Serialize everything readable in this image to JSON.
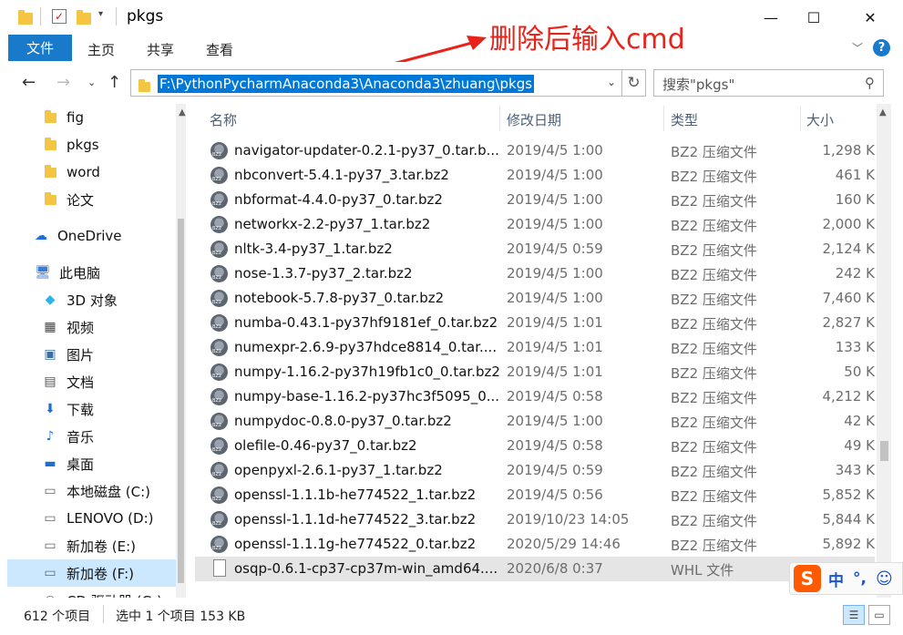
{
  "window": {
    "title": "pkgs",
    "minimize": "—",
    "maximize": "☐",
    "close": "✕"
  },
  "ribbon": {
    "tabs": [
      "文件",
      "主页",
      "共享",
      "查看"
    ],
    "help": "?"
  },
  "annotation": {
    "text": "删除后输入cmd",
    "color": "#e8231a"
  },
  "address": {
    "path": "F:\\PythonPycharmAnaconda3\\Anaconda3\\zhuang\\pkgs",
    "refresh": "↻"
  },
  "search": {
    "placeholder": "搜索\"pkgs\""
  },
  "sidebar": {
    "items": [
      {
        "label": "fig",
        "icon": "folder-icon"
      },
      {
        "label": "pkgs",
        "icon": "folder-icon"
      },
      {
        "label": "word",
        "icon": "folder-icon"
      },
      {
        "label": "论文",
        "icon": "folder-icon"
      },
      {
        "label": "OneDrive",
        "icon": "cloud-icon"
      },
      {
        "label": "此电脑",
        "icon": "computer-icon"
      },
      {
        "label": "3D 对象",
        "icon": "cube-icon"
      },
      {
        "label": "视频",
        "icon": "film-icon"
      },
      {
        "label": "图片",
        "icon": "picture-icon"
      },
      {
        "label": "文档",
        "icon": "document-icon"
      },
      {
        "label": "下载",
        "icon": "download-icon"
      },
      {
        "label": "音乐",
        "icon": "music-icon"
      },
      {
        "label": "桌面",
        "icon": "desktop-icon"
      },
      {
        "label": "本地磁盘 (C:)",
        "icon": "drive-icon"
      },
      {
        "label": "LENOVO (D:)",
        "icon": "drive-icon"
      },
      {
        "label": "新加卷 (E:)",
        "icon": "drive-icon"
      },
      {
        "label": "新加卷 (F:)",
        "icon": "drive-icon"
      },
      {
        "label": "CD 驱动器 (G:)",
        "icon": "cd-drive-icon"
      }
    ]
  },
  "columns": {
    "name": "名称",
    "date": "修改日期",
    "type": "类型",
    "size": "大小"
  },
  "files": [
    {
      "name": "navigator-updater-0.2.1-py37_0.tar.b...",
      "date": "2019/4/5 1:00",
      "type": "BZ2 压缩文件",
      "size": "1,298 K"
    },
    {
      "name": "nbconvert-5.4.1-py37_3.tar.bz2",
      "date": "2019/4/5 1:00",
      "type": "BZ2 压缩文件",
      "size": "461 K"
    },
    {
      "name": "nbformat-4.4.0-py37_0.tar.bz2",
      "date": "2019/4/5 1:00",
      "type": "BZ2 压缩文件",
      "size": "160 K"
    },
    {
      "name": "networkx-2.2-py37_1.tar.bz2",
      "date": "2019/4/5 1:00",
      "type": "BZ2 压缩文件",
      "size": "2,000 K"
    },
    {
      "name": "nltk-3.4-py37_1.tar.bz2",
      "date": "2019/4/5 0:59",
      "type": "BZ2 压缩文件",
      "size": "2,124 K"
    },
    {
      "name": "nose-1.3.7-py37_2.tar.bz2",
      "date": "2019/4/5 1:00",
      "type": "BZ2 压缩文件",
      "size": "242 K"
    },
    {
      "name": "notebook-5.7.8-py37_0.tar.bz2",
      "date": "2019/4/5 1:00",
      "type": "BZ2 压缩文件",
      "size": "7,460 K"
    },
    {
      "name": "numba-0.43.1-py37hf9181ef_0.tar.bz2",
      "date": "2019/4/5 1:01",
      "type": "BZ2 压缩文件",
      "size": "2,827 K"
    },
    {
      "name": "numexpr-2.6.9-py37hdce8814_0.tar....",
      "date": "2019/4/5 1:01",
      "type": "BZ2 压缩文件",
      "size": "133 K"
    },
    {
      "name": "numpy-1.16.2-py37h19fb1c0_0.tar.bz2",
      "date": "2019/4/5 1:01",
      "type": "BZ2 压缩文件",
      "size": "50 K"
    },
    {
      "name": "numpy-base-1.16.2-py37hc3f5095_0....",
      "date": "2019/4/5 0:58",
      "type": "BZ2 压缩文件",
      "size": "4,212 K"
    },
    {
      "name": "numpydoc-0.8.0-py37_0.tar.bz2",
      "date": "2019/4/5 1:00",
      "type": "BZ2 压缩文件",
      "size": "42 K"
    },
    {
      "name": "olefile-0.46-py37_0.tar.bz2",
      "date": "2019/4/5 0:58",
      "type": "BZ2 压缩文件",
      "size": "49 K"
    },
    {
      "name": "openpyxl-2.6.1-py37_1.tar.bz2",
      "date": "2019/4/5 0:59",
      "type": "BZ2 压缩文件",
      "size": "343 K"
    },
    {
      "name": "openssl-1.1.1b-he774522_1.tar.bz2",
      "date": "2019/4/5 0:56",
      "type": "BZ2 压缩文件",
      "size": "5,852 K"
    },
    {
      "name": "openssl-1.1.1d-he774522_3.tar.bz2",
      "date": "2019/10/23 14:05",
      "type": "BZ2 压缩文件",
      "size": "5,844 K"
    },
    {
      "name": "openssl-1.1.1g-he774522_0.tar.bz2",
      "date": "2020/5/29 14:46",
      "type": "BZ2 压缩文件",
      "size": "5,892 K"
    },
    {
      "name": "osqp-0.6.1-cp37-cp37m-win_amd64....",
      "date": "2020/6/8 0:37",
      "type": "WHL 文件",
      "size": "",
      "kind": "whl",
      "selected": true
    }
  ],
  "status": {
    "count": "612 个项目",
    "selection": "选中 1 个项目  153 KB"
  },
  "ime": {
    "logo": "S",
    "mode": "中",
    "punct": "°,",
    "emoji": "☺"
  }
}
